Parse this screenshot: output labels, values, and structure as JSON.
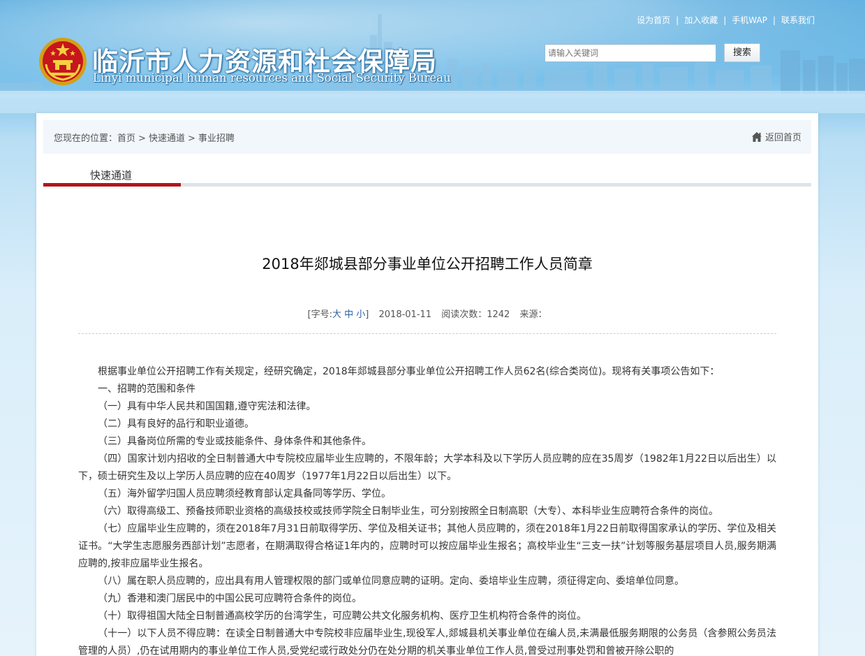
{
  "header": {
    "title": "临沂市人力资源和社会保障局",
    "subtitle": "Linyi municipal human resources and Social Security Bureau",
    "links": [
      "设为首页",
      "加入收藏",
      "手机WAP",
      "联系我们"
    ],
    "search": {
      "placeholder": "请输入关键词",
      "button_label": "搜索"
    }
  },
  "breadcrumb": {
    "prefix": "您现在的位置：",
    "items": [
      "首页",
      "快速通道",
      "事业招聘"
    ],
    "separator": ">",
    "home_link": "返回首页"
  },
  "tab": {
    "label": "快速通道"
  },
  "article": {
    "title": "2018年郯城县部分事业单位公开招聘工作人员简章",
    "meta": {
      "font_size_label": "[字号:",
      "font_sizes": [
        "大",
        "中",
        "小"
      ],
      "font_size_close": "]",
      "date": "2018-01-11",
      "read_count": "阅读次数：1242",
      "source": "来源："
    },
    "paragraphs": [
      "根据事业单位公开招聘工作有关规定，经研究确定，2018年郯城县部分事业单位公开招聘工作人员62名(综合类岗位)。现将有关事项公告如下：",
      "一、招聘的范围和条件",
      "（一）具有中华人民共和国国籍,遵守宪法和法律。",
      "（二）具有良好的品行和职业道德。",
      "（三）具备岗位所需的专业或技能条件、身体条件和其他条件。",
      "（四）国家计划内招收的全日制普通大中专院校应届毕业生应聘的，不限年龄；大学本科及以下学历人员应聘的应在35周岁（1982年1月22日以后出生）以下，硕士研究生及以上学历人员应聘的应在40周岁（1977年1月22日以后出生）以下。",
      "（五）海外留学归国人员应聘须经教育部认定具备同等学历、学位。",
      "（六）取得高级工、预备技师职业资格的高级技校或技师学院全日制毕业生，可分别按照全日制高职（大专）、本科毕业生应聘符合条件的岗位。",
      "（七）应届毕业生应聘的，须在2018年7月31日前取得学历、学位及相关证书；其他人员应聘的，须在2018年1月22日前取得国家承认的学历、学位及相关证书。“大学生志愿服务西部计划”志愿者，在期满取得合格证1年内的，应聘时可以按应届毕业生报名；高校毕业生“三支一扶”计划等服务基层项目人员,服务期满应聘的,按非应届毕业生报名。",
      "（八）属在职人员应聘的，应出具有用人管理权限的部门或单位同意应聘的证明。定向、委培毕业生应聘，须征得定向、委培单位同意。",
      "（九）香港和澳门居民中的中国公民可应聘符合条件的岗位。",
      "（十）取得祖国大陆全日制普通高校学历的台湾学生，可应聘公共文化服务机构、医疗卫生机构符合条件的岗位。",
      "（十一）以下人员不得应聘：在读全日制普通大中专院校非应届毕业生,现役军人,郯城县机关事业单位在编人员,未满最低服务期限的公务员（含参照公务员法管理的人员）,仍在试用期内的事业单位工作人员,受党纪或行政处分仍在处分期的机关事业单位工作人员,曾受过刑事处罚和曾被开除公职的"
    ]
  },
  "colors": {
    "accent_red": "#b3141b",
    "link_blue": "#2a62a6",
    "header_blue": "#4aa5dc"
  }
}
